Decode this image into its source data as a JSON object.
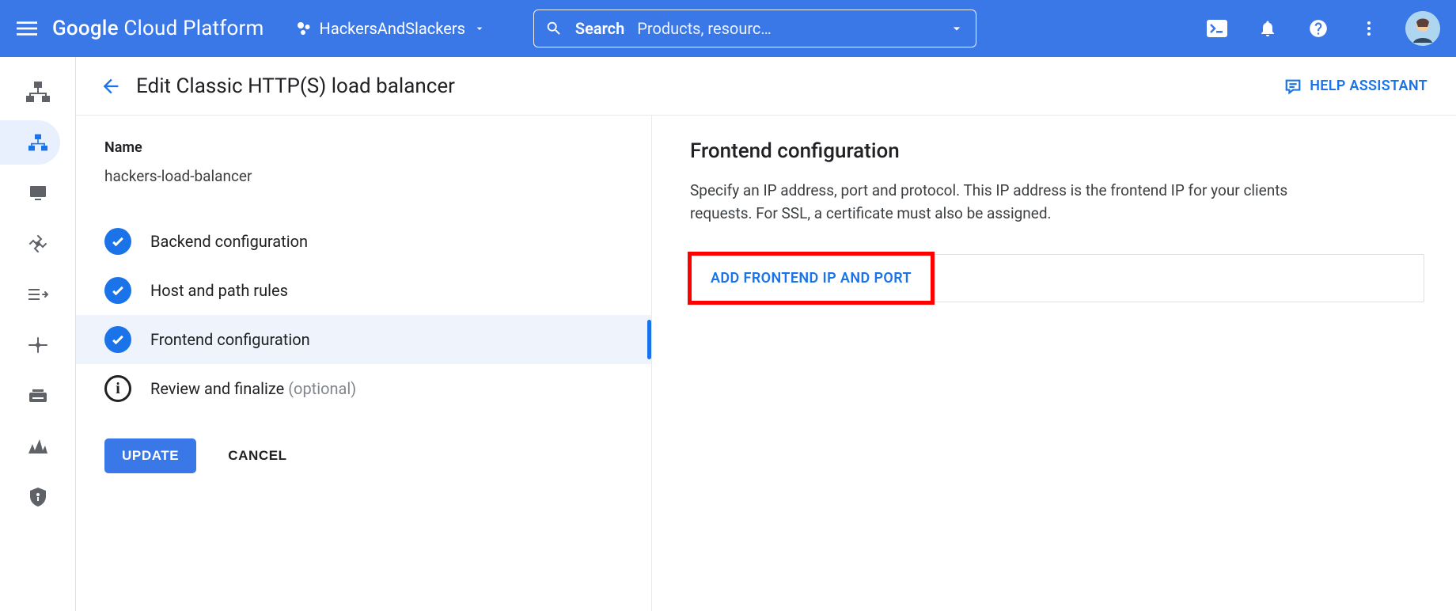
{
  "header": {
    "product_name_1": "Google",
    "product_name_2": "Cloud Platform",
    "project_name": "HackersAndSlackers",
    "search_label": "Search",
    "search_placeholder": "Products, resourc…"
  },
  "page": {
    "title": "Edit Classic HTTP(S) load balancer",
    "help_assistant": "HELP ASSISTANT"
  },
  "left_panel": {
    "name_label": "Name",
    "name_value": "hackers-load-balancer",
    "steps": [
      {
        "label": "Backend configuration",
        "status": "done"
      },
      {
        "label": "Host and path rules",
        "status": "done"
      },
      {
        "label": "Frontend configuration",
        "status": "done",
        "selected": true
      },
      {
        "label": "Review and finalize",
        "status": "info",
        "optional_label": "(optional)"
      }
    ],
    "update_label": "UPDATE",
    "cancel_label": "CANCEL"
  },
  "right_panel": {
    "title": "Frontend configuration",
    "description": "Specify an IP address, port and protocol. This IP address is the frontend IP for your clients requests. For SSL, a certificate must also be assigned.",
    "add_button": "ADD FRONTEND IP AND PORT"
  },
  "icons": {
    "hamburger": "hamburger-icon",
    "search": "search-icon",
    "dropdown": "chevron-down-icon",
    "cloudshell": "cloud-shell-icon",
    "bell": "bell-icon",
    "help": "help-icon",
    "more": "more-vert-icon",
    "avatar": "avatar-icon",
    "back": "arrow-back-icon",
    "chat": "chat-icon"
  }
}
